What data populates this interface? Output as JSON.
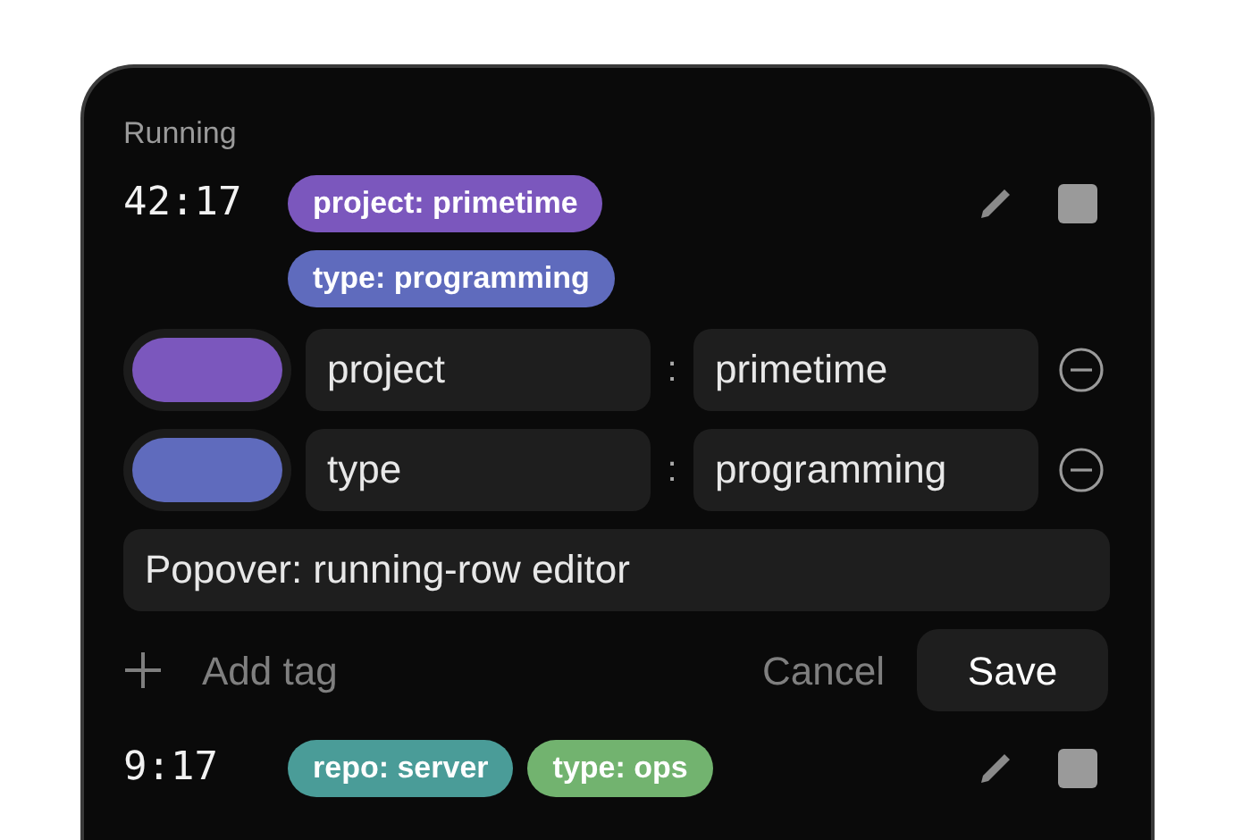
{
  "section_label": "Running",
  "rows": [
    {
      "elapsed": "42:17",
      "tags": [
        {
          "label": "project: primetime",
          "color": "#7b57bd"
        },
        {
          "label": "type: programming",
          "color": "#5f6bbd"
        }
      ],
      "editor": {
        "tag_rows": [
          {
            "color": "#7b57bd",
            "key": "project",
            "separator": ":",
            "value": "primetime"
          },
          {
            "color": "#5f6bbd",
            "key": "type",
            "separator": ":",
            "value": "programming"
          }
        ],
        "note": "Popover: running-row editor",
        "add_label": "Add tag",
        "cancel": "Cancel",
        "save": "Save"
      }
    },
    {
      "elapsed": "9:17",
      "tags": [
        {
          "label": "repo: server",
          "color": "#4a9c98"
        },
        {
          "label": "type: ops",
          "color": "#72b36f"
        }
      ]
    }
  ]
}
